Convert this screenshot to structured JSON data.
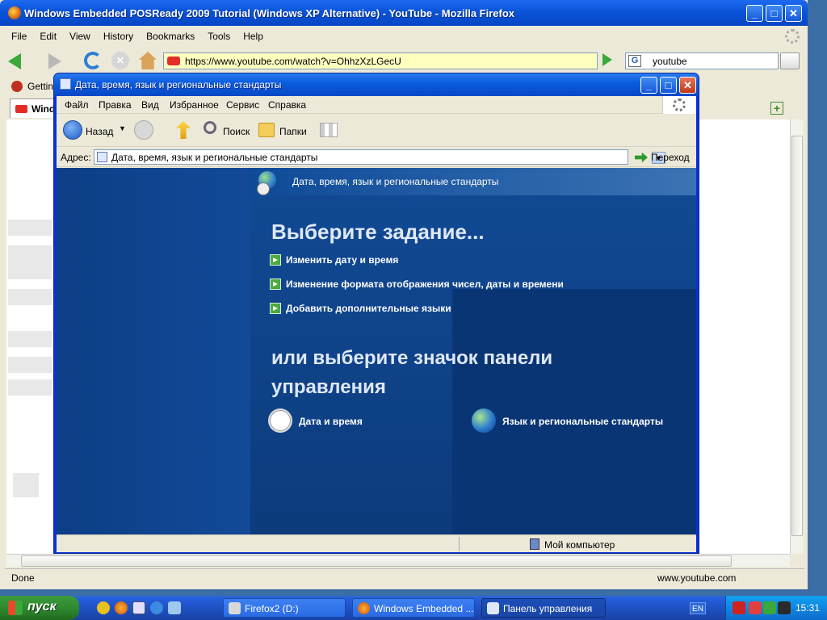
{
  "firefox": {
    "title": "Windows Embedded POSReady 2009 Tutorial (Windows XP Alternative) - YouTube - Mozilla Firefox",
    "menu": [
      "File",
      "Edit",
      "View",
      "History",
      "Bookmarks",
      "Tools",
      "Help"
    ],
    "url": "https://www.youtube.com/watch?v=OhhzXzLGecU",
    "search_value": "youtube",
    "bookmark_label": "Getting",
    "tab_label": "Wind",
    "status_left": "Done",
    "status_right": "www.youtube.com"
  },
  "explorer": {
    "title": "Дата, время, язык и региональные стандарты",
    "menu": [
      "Файл",
      "Правка",
      "Вид",
      "Избранное",
      "Сервис",
      "Справка"
    ],
    "toolbar": {
      "back": "Назад",
      "search": "Поиск",
      "folders": "Папки"
    },
    "address_label": "Адрес:",
    "address_value": "Дата, время, язык и региональные стандарты",
    "go_label": "Переход",
    "header": "Дата, время, язык и региональные стандарты",
    "pick_task": "Выберите задание...",
    "tasks": [
      "Изменить дату и время",
      "Изменение формата отображения чисел, даты и времени",
      "Добавить дополнительные языки"
    ],
    "pick_icon": "или выберите значок панели управления",
    "icons": [
      "Дата и время",
      "Язык и региональные стандарты"
    ],
    "status": "Мой компьютер"
  },
  "taskbar": {
    "start": "пуск",
    "buttons": [
      "Firefox2 (D:)",
      "Windows Embedded ...",
      "Панель управления"
    ],
    "lang": "EN",
    "clock": "15:31"
  }
}
